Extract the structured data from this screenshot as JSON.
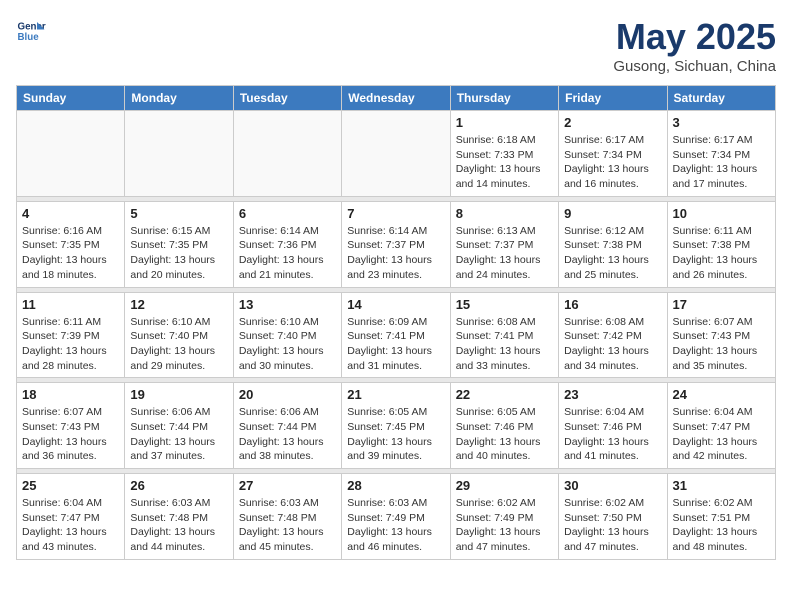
{
  "header": {
    "logo_line1": "General",
    "logo_line2": "Blue",
    "month": "May 2025",
    "location": "Gusong, Sichuan, China"
  },
  "days_of_week": [
    "Sunday",
    "Monday",
    "Tuesday",
    "Wednesday",
    "Thursday",
    "Friday",
    "Saturday"
  ],
  "weeks": [
    [
      {
        "day": "",
        "info": ""
      },
      {
        "day": "",
        "info": ""
      },
      {
        "day": "",
        "info": ""
      },
      {
        "day": "",
        "info": ""
      },
      {
        "day": "1",
        "info": "Sunrise: 6:18 AM\nSunset: 7:33 PM\nDaylight: 13 hours\nand 14 minutes."
      },
      {
        "day": "2",
        "info": "Sunrise: 6:17 AM\nSunset: 7:34 PM\nDaylight: 13 hours\nand 16 minutes."
      },
      {
        "day": "3",
        "info": "Sunrise: 6:17 AM\nSunset: 7:34 PM\nDaylight: 13 hours\nand 17 minutes."
      }
    ],
    [
      {
        "day": "4",
        "info": "Sunrise: 6:16 AM\nSunset: 7:35 PM\nDaylight: 13 hours\nand 18 minutes."
      },
      {
        "day": "5",
        "info": "Sunrise: 6:15 AM\nSunset: 7:35 PM\nDaylight: 13 hours\nand 20 minutes."
      },
      {
        "day": "6",
        "info": "Sunrise: 6:14 AM\nSunset: 7:36 PM\nDaylight: 13 hours\nand 21 minutes."
      },
      {
        "day": "7",
        "info": "Sunrise: 6:14 AM\nSunset: 7:37 PM\nDaylight: 13 hours\nand 23 minutes."
      },
      {
        "day": "8",
        "info": "Sunrise: 6:13 AM\nSunset: 7:37 PM\nDaylight: 13 hours\nand 24 minutes."
      },
      {
        "day": "9",
        "info": "Sunrise: 6:12 AM\nSunset: 7:38 PM\nDaylight: 13 hours\nand 25 minutes."
      },
      {
        "day": "10",
        "info": "Sunrise: 6:11 AM\nSunset: 7:38 PM\nDaylight: 13 hours\nand 26 minutes."
      }
    ],
    [
      {
        "day": "11",
        "info": "Sunrise: 6:11 AM\nSunset: 7:39 PM\nDaylight: 13 hours\nand 28 minutes."
      },
      {
        "day": "12",
        "info": "Sunrise: 6:10 AM\nSunset: 7:40 PM\nDaylight: 13 hours\nand 29 minutes."
      },
      {
        "day": "13",
        "info": "Sunrise: 6:10 AM\nSunset: 7:40 PM\nDaylight: 13 hours\nand 30 minutes."
      },
      {
        "day": "14",
        "info": "Sunrise: 6:09 AM\nSunset: 7:41 PM\nDaylight: 13 hours\nand 31 minutes."
      },
      {
        "day": "15",
        "info": "Sunrise: 6:08 AM\nSunset: 7:41 PM\nDaylight: 13 hours\nand 33 minutes."
      },
      {
        "day": "16",
        "info": "Sunrise: 6:08 AM\nSunset: 7:42 PM\nDaylight: 13 hours\nand 34 minutes."
      },
      {
        "day": "17",
        "info": "Sunrise: 6:07 AM\nSunset: 7:43 PM\nDaylight: 13 hours\nand 35 minutes."
      }
    ],
    [
      {
        "day": "18",
        "info": "Sunrise: 6:07 AM\nSunset: 7:43 PM\nDaylight: 13 hours\nand 36 minutes."
      },
      {
        "day": "19",
        "info": "Sunrise: 6:06 AM\nSunset: 7:44 PM\nDaylight: 13 hours\nand 37 minutes."
      },
      {
        "day": "20",
        "info": "Sunrise: 6:06 AM\nSunset: 7:44 PM\nDaylight: 13 hours\nand 38 minutes."
      },
      {
        "day": "21",
        "info": "Sunrise: 6:05 AM\nSunset: 7:45 PM\nDaylight: 13 hours\nand 39 minutes."
      },
      {
        "day": "22",
        "info": "Sunrise: 6:05 AM\nSunset: 7:46 PM\nDaylight: 13 hours\nand 40 minutes."
      },
      {
        "day": "23",
        "info": "Sunrise: 6:04 AM\nSunset: 7:46 PM\nDaylight: 13 hours\nand 41 minutes."
      },
      {
        "day": "24",
        "info": "Sunrise: 6:04 AM\nSunset: 7:47 PM\nDaylight: 13 hours\nand 42 minutes."
      }
    ],
    [
      {
        "day": "25",
        "info": "Sunrise: 6:04 AM\nSunset: 7:47 PM\nDaylight: 13 hours\nand 43 minutes."
      },
      {
        "day": "26",
        "info": "Sunrise: 6:03 AM\nSunset: 7:48 PM\nDaylight: 13 hours\nand 44 minutes."
      },
      {
        "day": "27",
        "info": "Sunrise: 6:03 AM\nSunset: 7:48 PM\nDaylight: 13 hours\nand 45 minutes."
      },
      {
        "day": "28",
        "info": "Sunrise: 6:03 AM\nSunset: 7:49 PM\nDaylight: 13 hours\nand 46 minutes."
      },
      {
        "day": "29",
        "info": "Sunrise: 6:02 AM\nSunset: 7:49 PM\nDaylight: 13 hours\nand 47 minutes."
      },
      {
        "day": "30",
        "info": "Sunrise: 6:02 AM\nSunset: 7:50 PM\nDaylight: 13 hours\nand 47 minutes."
      },
      {
        "day": "31",
        "info": "Sunrise: 6:02 AM\nSunset: 7:51 PM\nDaylight: 13 hours\nand 48 minutes."
      }
    ]
  ]
}
